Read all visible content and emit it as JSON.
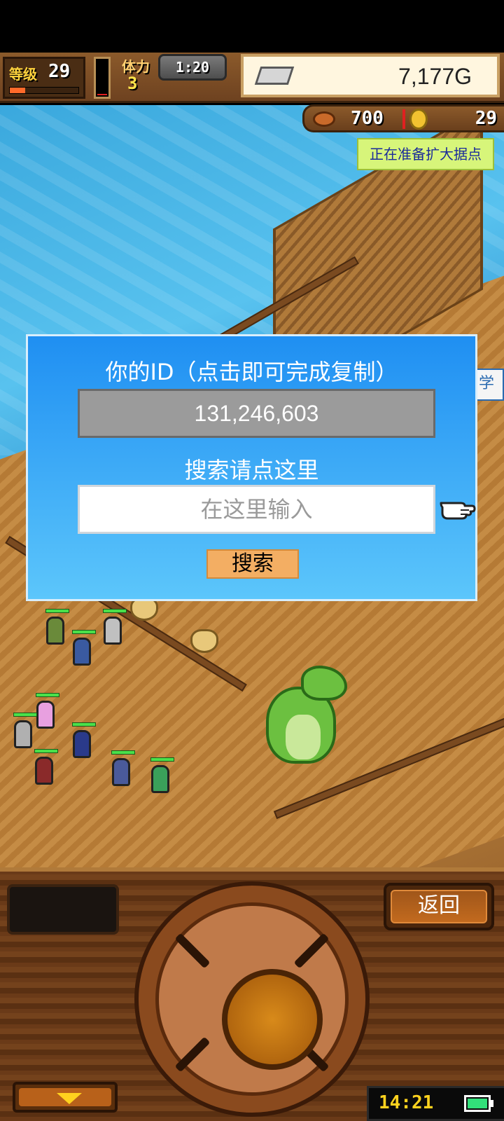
{
  "hud": {
    "level_label": "等级",
    "level_value": "29",
    "level_progress": 0.22,
    "hp_level": 0.12,
    "stamina_label": "体力",
    "stamina_value": "3",
    "timer": "1:20",
    "money": "7,177G",
    "resource_1": "700",
    "resource_2": "29"
  },
  "scene": {
    "event_badge": "正在准备扩大据点",
    "side_tab_partial": "学行"
  },
  "dialog": {
    "title": "你的ID（点击即可完成复制）",
    "player_id": "131,246,603",
    "search_caption": "搜索请点这里",
    "search_placeholder": "在这里输入",
    "search_button": "搜索"
  },
  "controls": {
    "back_button": "返回",
    "clock": "14:21",
    "battery_level": 1.0
  },
  "colors": {
    "dialog_top": "#1f8ff2",
    "dialog_bottom": "#5cc6fb",
    "search_button_bg": "#f3ae63",
    "event_badge_bg": "#d7f57a",
    "event_badge_text": "#1a2a9a"
  },
  "icons": [
    "silver-bar-icon",
    "meat-icon",
    "coin-icon",
    "pointing-hand-icon",
    "chevron-down-icon",
    "battery-icon"
  ]
}
